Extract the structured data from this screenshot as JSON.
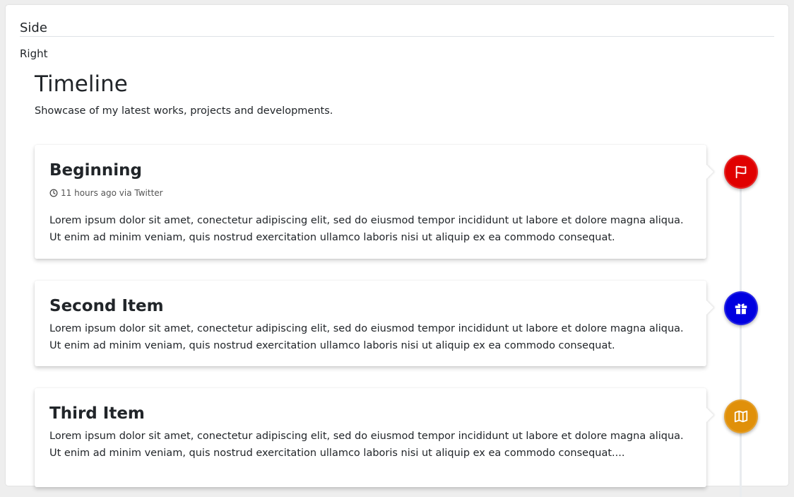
{
  "side": {
    "header": "Side",
    "subheader": "Right"
  },
  "timeline": {
    "title": "Timeline",
    "description": "Showcase of my latest works, projects and developments.",
    "items": [
      {
        "title": "Beginning",
        "meta": "11 hours ago via Twitter",
        "body": "Lorem ipsum dolor sit amet, conectetur adipiscing elit, sed do eiusmod tempor incididunt ut labore et dolore magna aliqua. Ut enim ad minim veniam, quis nostrud exercitation ullamco laboris nisi ut aliquip ex ea commodo consequat.",
        "icon": "flag-icon",
        "color": "#e00000"
      },
      {
        "title": "Second Item",
        "body": "Lorem ipsum dolor sit amet, conectetur adipiscing elit, sed do eiusmod tempor incididunt ut labore et dolore magna aliqua. Ut enim ad minim veniam, quis nostrud exercitation ullamco laboris nisi ut aliquip ex ea commodo consequat.",
        "icon": "gift-icon",
        "color": "#0000e0"
      },
      {
        "title": "Third Item",
        "body": "Lorem ipsum dolor sit amet, conectetur adipiscing elit, sed do eiusmod tempor incididunt ut labore et dolore magna aliqua. Ut enim ad minim veniam, quis nostrud exercitation ullamco laboris nisi ut aliquip ex ea commodo consequat....",
        "icon": "map-icon",
        "color": "#e0900a"
      }
    ]
  }
}
